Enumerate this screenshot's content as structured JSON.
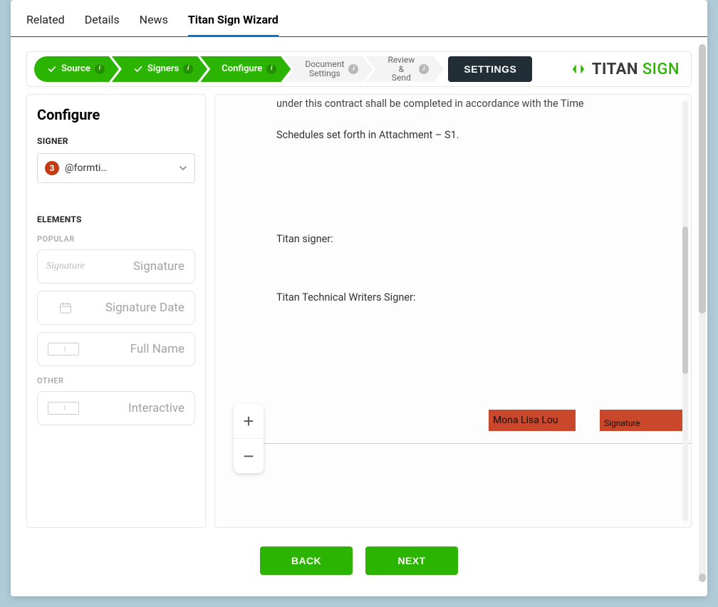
{
  "tabs": {
    "related": "Related",
    "details": "Details",
    "news": "News",
    "wizard": "Titan Sign Wizard"
  },
  "steps": {
    "source": "Source",
    "signers": "Signers",
    "configure": "Configure",
    "docsettings_l1": "Document",
    "docsettings_l2": "Settings",
    "review_l1": "Review",
    "review_l2": "&",
    "review_l3": "Send",
    "settings_btn": "SETTINGS"
  },
  "brand": {
    "word1": "TITAN",
    "word2": "SIGN"
  },
  "side": {
    "title": "Configure",
    "signer_label": "SIGNER",
    "signer_badge": "3",
    "signer_value": "@formti…",
    "elements_label": "ELEMENTS",
    "popular_label": "POPULAR",
    "other_label": "OTHER",
    "sig_icon_text": "Signature",
    "box_icon_text": "I",
    "el_signature": "Signature",
    "el_sigdate": "Signature Date",
    "el_fullname": "Full Name",
    "el_interactive": "Interactive"
  },
  "doc": {
    "line_top": "under this contract shall be completed in accordance with the Time",
    "line_schedules": "Schedules set forth in Attachment – S1.",
    "line_titan_signer": "Titan signer:",
    "line_writers": "Titan Technical Writers  Signer:",
    "field_a_text": "Mona Lisa Lou",
    "field_b_text": "Signature"
  },
  "zoom": {
    "in": "+",
    "out": "−"
  },
  "footer": {
    "back": "BACK",
    "next": "NEXT"
  },
  "icons": {
    "info": "i",
    "rotate": "↻"
  }
}
